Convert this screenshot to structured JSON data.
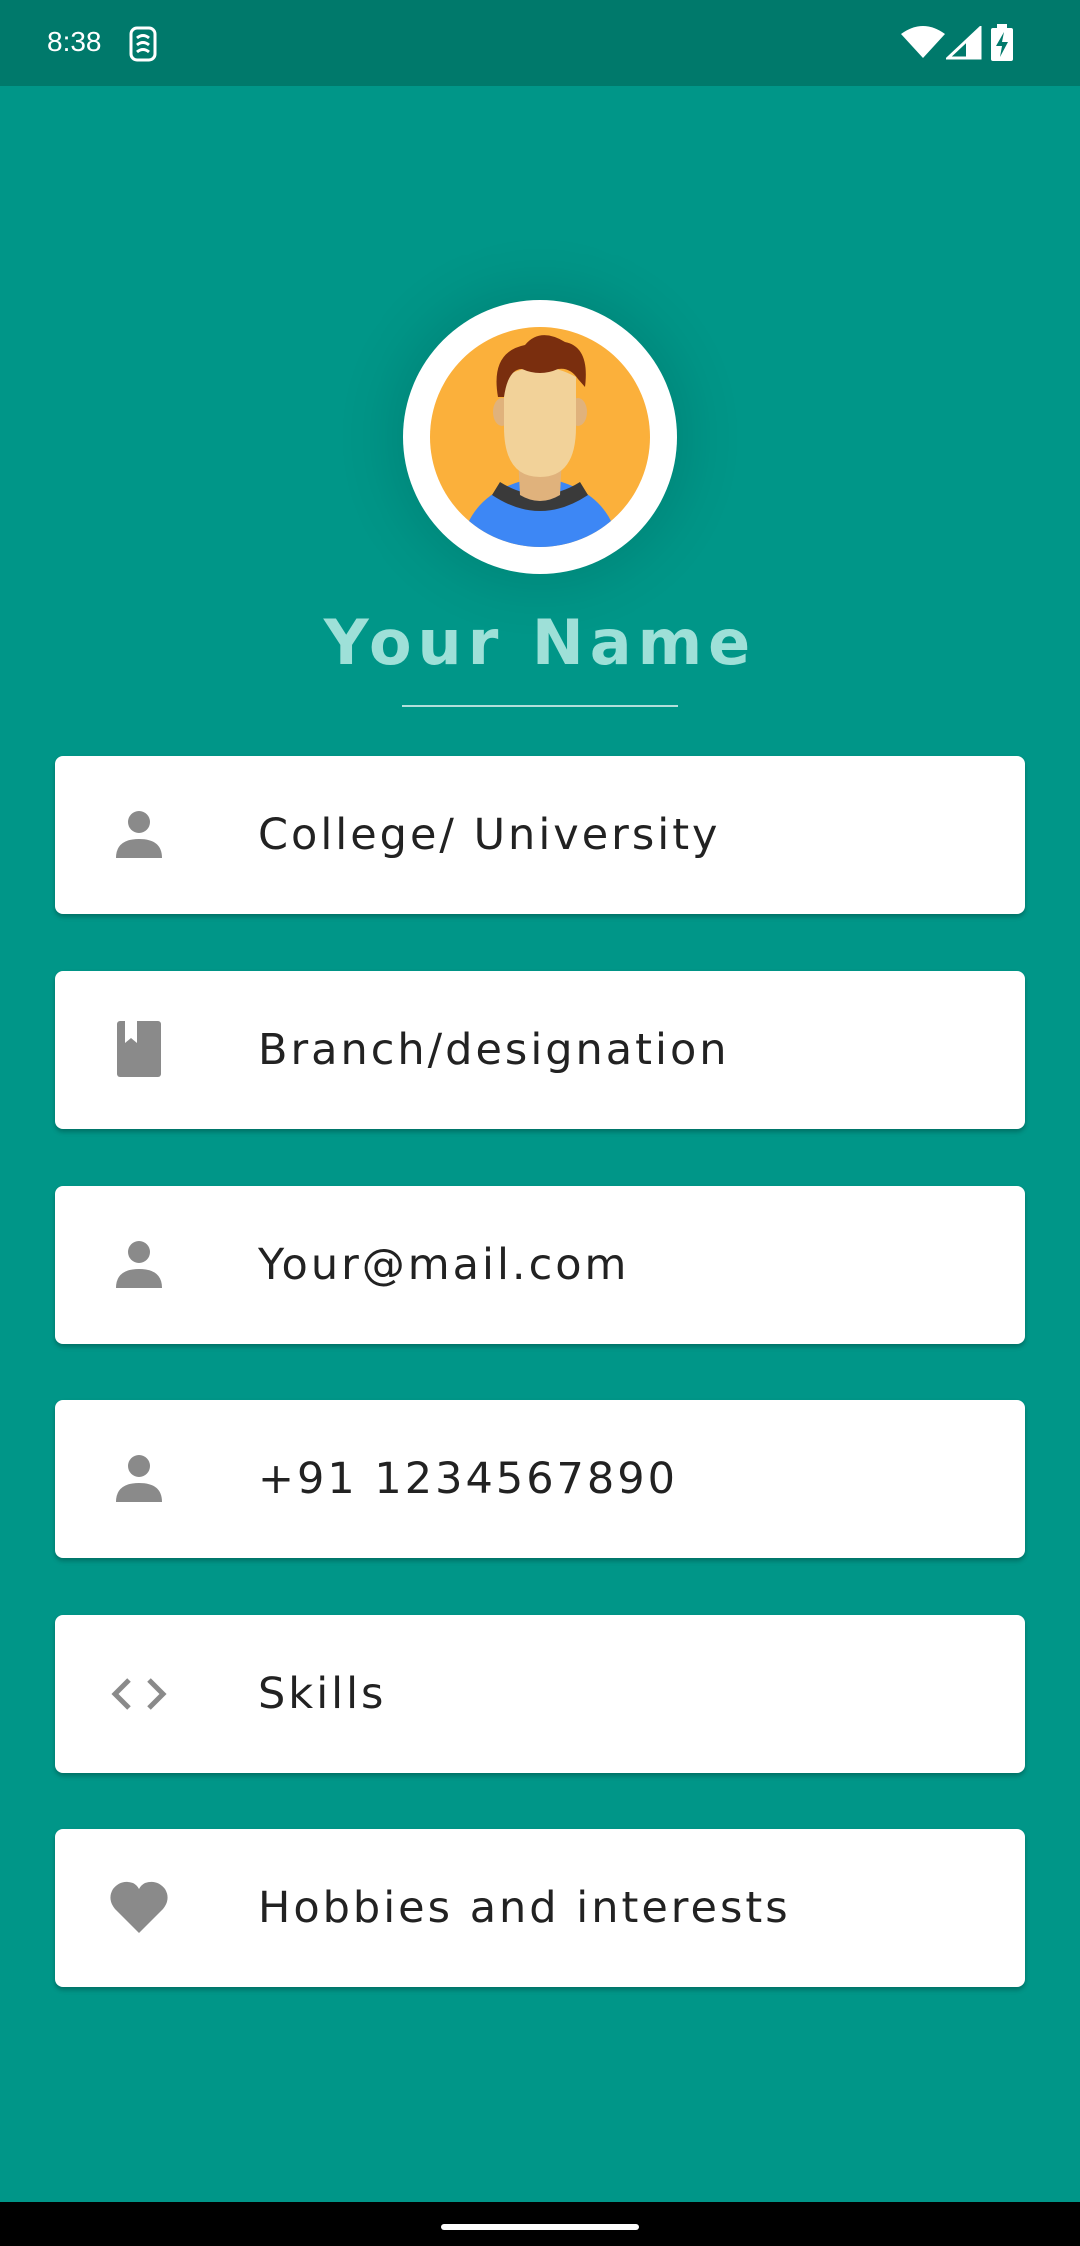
{
  "status_bar": {
    "time": "8:38",
    "icons": [
      "sim-card-icon",
      "wifi-icon",
      "cell-signal-icon",
      "battery-charging-icon"
    ]
  },
  "profile": {
    "name": "Your Name",
    "avatar_icon": "avatar-icon"
  },
  "fields": [
    {
      "label": "College/ University",
      "icon": "person-icon"
    },
    {
      "label": "Branch/designation",
      "icon": "book-icon"
    },
    {
      "label": "Your@mail.com",
      "icon": "person-icon"
    },
    {
      "label": "+91 1234567890",
      "icon": "person-icon"
    },
    {
      "label": "Skills",
      "icon": "code-icon"
    },
    {
      "label": "Hobbies and interests",
      "icon": "heart-icon"
    }
  ],
  "colors": {
    "background": "#009688",
    "status_bar": "#00796b",
    "card": "#ffffff",
    "title": "#9ee0d8",
    "icon": "#8a8a8a"
  }
}
